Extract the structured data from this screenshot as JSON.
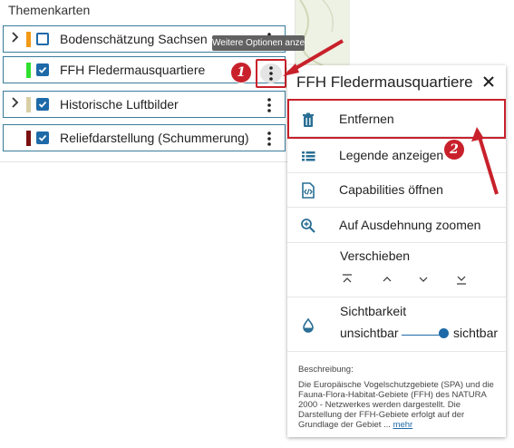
{
  "left_panel": {
    "title": "Themenkarten",
    "layers": [
      {
        "label": "Bodenschätzung Sachsen",
        "color": "#f29a17",
        "checked": false,
        "expandable": true
      },
      {
        "label": "FFH Fledermausquartiere",
        "color": "#2fe02f",
        "checked": true,
        "expandable": false
      },
      {
        "label": "Historische Luftbilder",
        "color": "#d9cfa6",
        "checked": true,
        "expandable": true
      },
      {
        "label": "Reliefdarstellung (Schummerung)",
        "color": "#7a1010",
        "checked": true,
        "expandable": false
      }
    ],
    "tooltip": "Weitere Optionen anzeigen"
  },
  "context_menu": {
    "title": "FFH Fledermausquartiere",
    "items": {
      "remove": "Entfernen",
      "legend": "Legende anzeigen",
      "capabilities": "Capabilities öffnen",
      "zoom": "Auf Ausdehnung zoomen"
    },
    "move_label": "Verschieben",
    "visibility": {
      "label": "Sichtbarkeit",
      "min_label": "unsichtbar",
      "max_label": "sichtbar",
      "value": 1.0
    },
    "description_label": "Beschreibung:",
    "description_text": "Die Europäische Vogelschutzgebiete (SPA) und die Fauna-Flora-Habitat-Gebiete (FFH) des NATURA 2000 - Netzwerkes werden dargestellt. Die Darstellung der FFH-Gebiete erfolgt auf der Grundlage der Gebiet ...",
    "more_link": "mehr"
  },
  "annotations": {
    "step1": "1",
    "step2": "2"
  },
  "colors": {
    "accent": "#1e6aa8",
    "highlight": "#c8212b",
    "item_border": "#3a7c9a"
  },
  "icons": {
    "expand": "chevron-right-icon",
    "more": "more-vert-icon",
    "close": "close-icon",
    "remove": "trash-icon",
    "legend": "list-icon",
    "capabilities": "xml-file-icon",
    "zoom": "zoom-in-icon",
    "move_top": "move-to-top-icon",
    "move_up": "move-up-icon",
    "move_down": "move-down-icon",
    "move_bottom": "move-to-bottom-icon",
    "visibility": "opacity-drop-icon"
  }
}
